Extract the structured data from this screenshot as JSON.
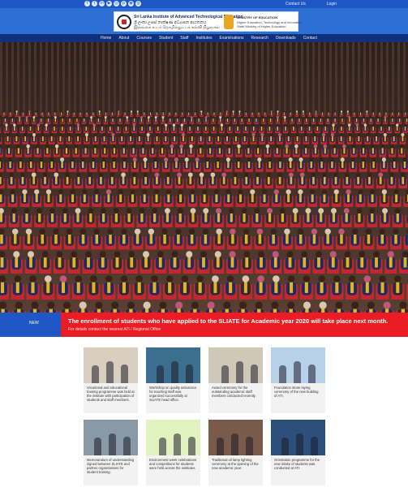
{
  "social": {
    "icons": [
      "facebook-icon",
      "twitter-icon",
      "linkedin-icon",
      "youtube-icon",
      "instagram-icon",
      "pinterest-icon",
      "rss-icon",
      "google-plus-icon"
    ],
    "glyphs": [
      "f",
      "t",
      "in",
      "▶",
      "◎",
      "p",
      "◉",
      "g"
    ]
  },
  "toplinks": [
    "Contact Us",
    "Login"
  ],
  "header": {
    "institute_en": "Sri Lanka Institute of Advanced Technological Education",
    "institute_si": "ශ්‍රී ලංකා උසස් තාක්ෂණ අධ්‍යාපන ආයතනය",
    "institute_ta": "இலங்கை உயர் தொழில்நுட்பக் கல்வி நிறுவகம்",
    "ministry_line1": "MINISTRY OF EDUCATION",
    "ministry_line2": "Higher Education, Technology and Innovation",
    "ministry_line3": "State Ministry of Higher Education"
  },
  "nav": {
    "items": [
      "Home",
      "About",
      "Courses",
      "Student",
      "Staff",
      "Institutes",
      "Examinations",
      "Research",
      "Downloads",
      "Contact"
    ]
  },
  "hero": {
    "alt": "Students in graduation gowns seated in an auditorium"
  },
  "banner": {
    "date": "NEW",
    "headline": "The enrollment of students who have applied to the SLIATE for Academic year 2020 will take place next month.",
    "subline": "For details contact the nearest ATI / Regional Office"
  },
  "news": [
    {
      "caption": "Vocational and educational training programme was held at the institute with participation of students and staff members.",
      "bg": "#d9cfc0"
    },
    {
      "caption": "Workshop on quality assurance for teaching staff was organized successfully at SLIATE head office.",
      "bg": "#3c6f8f"
    },
    {
      "caption": "Award ceremony for the outstanding academic staff members conducted recently.",
      "bg": "#cfc8b8"
    },
    {
      "caption": "Foundation stone laying ceremony of the new building of ATI.",
      "bg": "#b6d1e8"
    },
    {
      "caption": "Memorandum of understanding signed between SLIATE and partner organizations for student training.",
      "bg": "#8a99a8"
    },
    {
      "caption": "Environment week celebrations and competitions for students were held across the institutes.",
      "bg": "#dff2c0"
    },
    {
      "caption": "Traditional oil lamp lighting ceremony at the opening of the new academic year.",
      "bg": "#7a5a4a"
    },
    {
      "caption": "Orientation programme for the new intake of students was conducted at ATI.",
      "bg": "#2c4f7c"
    }
  ],
  "colors": {
    "topbar": "#1f57c6",
    "nav": "#11307c",
    "banner": "#ec1c24"
  }
}
